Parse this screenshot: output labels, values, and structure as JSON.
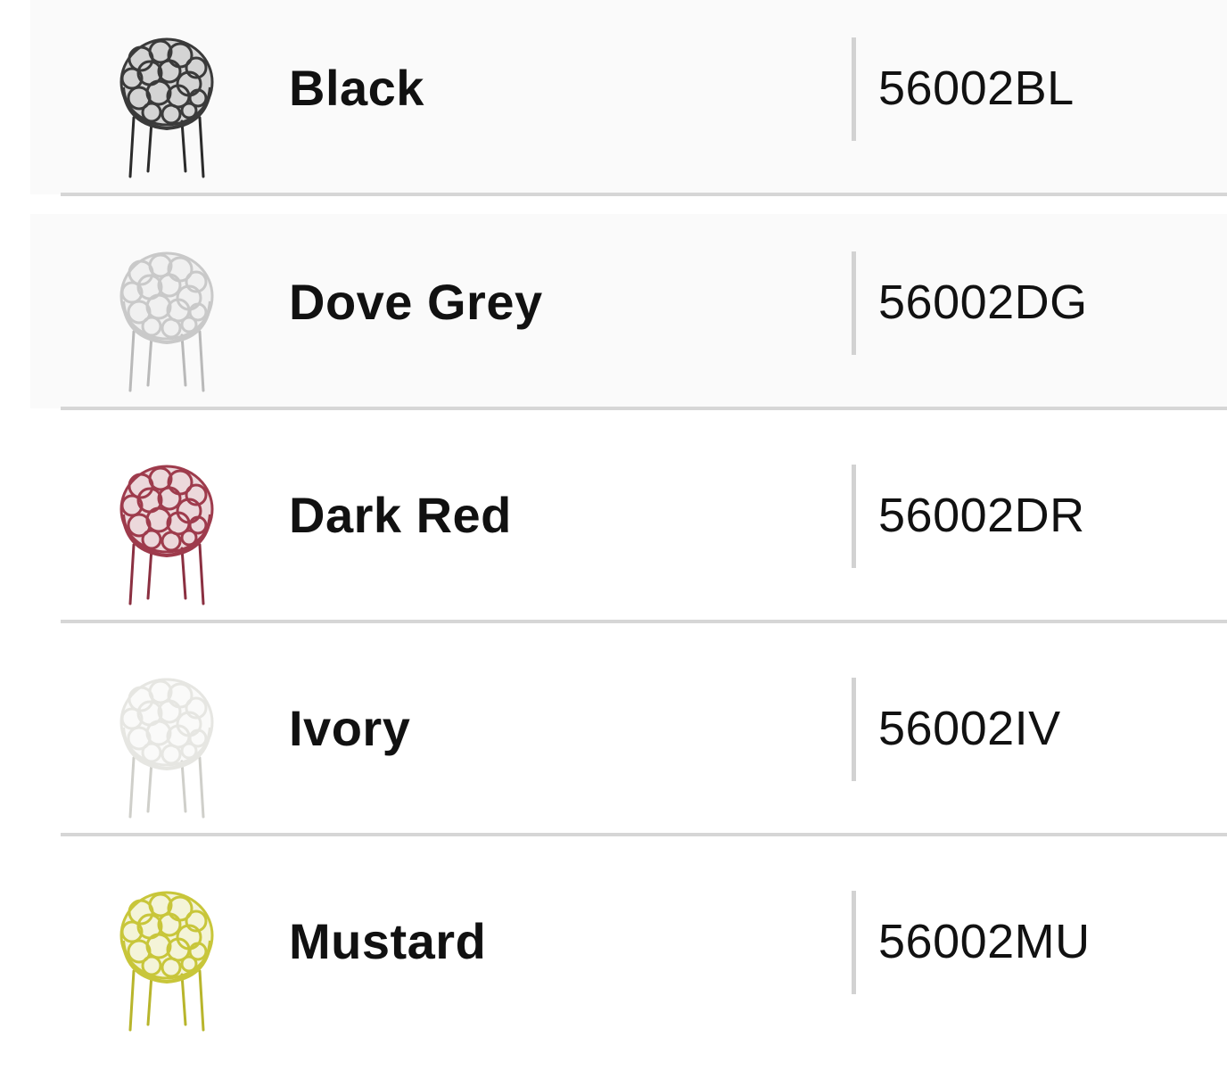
{
  "variants": [
    {
      "name": "Black",
      "code": "56002BL",
      "color": "#3a3a3a",
      "leg_color": "#2b2b2b",
      "icon": "chair-icon"
    },
    {
      "name": "Dove Grey",
      "code": "56002DG",
      "color": "#c9c9c9",
      "leg_color": "#b9b9b9",
      "icon": "chair-icon"
    },
    {
      "name": "Dark Red",
      "code": "56002DR",
      "color": "#9e3b4c",
      "leg_color": "#8b3041",
      "icon": "chair-icon"
    },
    {
      "name": "Ivory",
      "code": "56002IV",
      "color": "#e6e6e2",
      "leg_color": "#cfcfca",
      "icon": "chair-icon"
    },
    {
      "name": "Mustard",
      "code": "56002MU",
      "color": "#c8c63a",
      "leg_color": "#b8b52c",
      "icon": "chair-icon"
    }
  ]
}
